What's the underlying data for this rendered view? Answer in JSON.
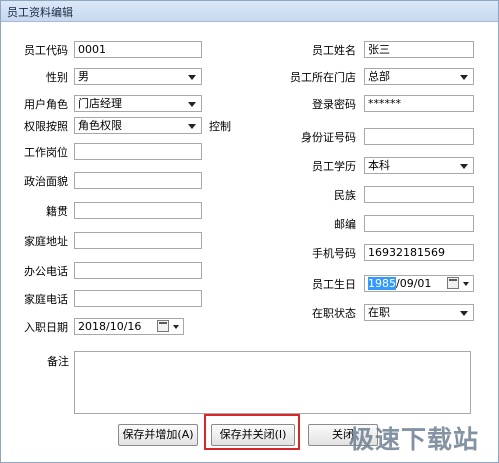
{
  "window": {
    "title": "员工资料编辑"
  },
  "form": {
    "employee_code": {
      "label": "员工代码",
      "value": "0001"
    },
    "employee_name": {
      "label": "员工姓名",
      "value": "张三"
    },
    "gender": {
      "label": "性别",
      "value": "男"
    },
    "store": {
      "label": "员工所在门店",
      "value": "总部"
    },
    "user_role": {
      "label": "用户角色",
      "value": "门店经理"
    },
    "login_password": {
      "label": "登录密码",
      "value": "******"
    },
    "permission": {
      "label": "权限按照",
      "value": "角色权限",
      "suffix": "控制"
    },
    "id_number": {
      "label": "身份证号码",
      "value": ""
    },
    "job_position": {
      "label": "工作岗位",
      "value": ""
    },
    "education": {
      "label": "员工学历",
      "value": "本科"
    },
    "political_status": {
      "label": "政治面貌",
      "value": ""
    },
    "ethnicity": {
      "label": "民族",
      "value": ""
    },
    "native_place": {
      "label": "籍贯",
      "value": ""
    },
    "postcode": {
      "label": "邮编",
      "value": ""
    },
    "home_address": {
      "label": "家庭地址",
      "value": ""
    },
    "mobile": {
      "label": "手机号码",
      "value": "16932181569"
    },
    "office_phone": {
      "label": "办公电话",
      "value": ""
    },
    "birthday": {
      "label": "员工生日",
      "year": "1985",
      "rest": "/09/01"
    },
    "home_phone": {
      "label": "家庭电话",
      "value": ""
    },
    "employment_status": {
      "label": "在职状态",
      "value": "在职"
    },
    "hire_date": {
      "label": "入职日期",
      "value": "2018/10/16"
    },
    "remarks": {
      "label": "备注",
      "value": ""
    }
  },
  "buttons": {
    "save_add": "保存并增加(A)",
    "save_close": "保存并关闭(I)",
    "close": "关闭"
  },
  "watermark": "极速下载站"
}
